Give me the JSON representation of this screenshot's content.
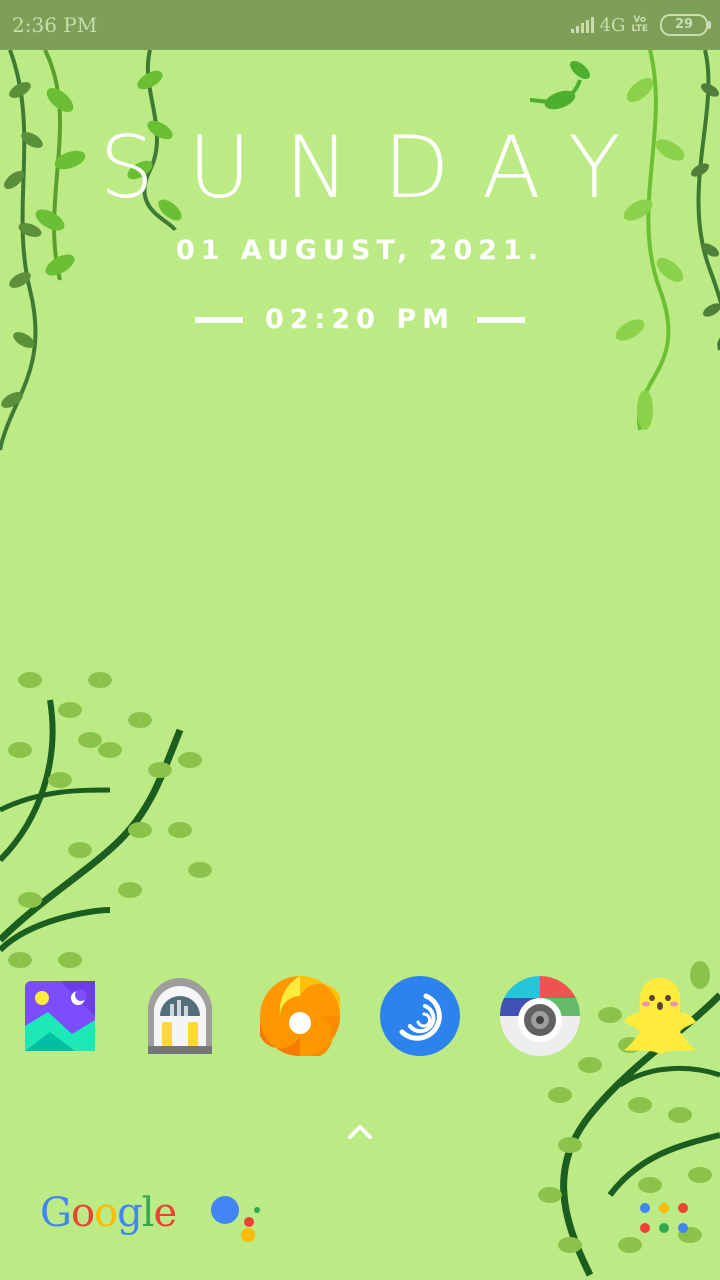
{
  "status_bar": {
    "time": "2:36 PM",
    "network": "4G",
    "volte": [
      "Vo",
      "LTE"
    ],
    "battery": "29"
  },
  "clock_widget": {
    "day": "SUNDAY",
    "date": "01 AUGUST, 2021.",
    "time": "02:20 PM"
  },
  "dock": {
    "apps": [
      {
        "icon": "gallery-icon"
      },
      {
        "icon": "soundcloud-radio-icon"
      },
      {
        "icon": "swirl-app-icon"
      },
      {
        "icon": "blue-spiral-app-icon"
      },
      {
        "icon": "camera-icon"
      },
      {
        "icon": "snapchat-ghost-icon"
      }
    ],
    "google_logo_letters": [
      "G",
      "o",
      "o",
      "g",
      "l",
      "e"
    ],
    "google_colors": [
      "#4285f4",
      "#ea4335",
      "#fbbc05",
      "#4285f4",
      "#34a853",
      "#ea4335"
    ]
  },
  "colors": {
    "wallpaper": "#bcea85",
    "status_bar": "#7e9f58",
    "leaf_light": "#8bc34a",
    "branch_dark": "#1b5e20"
  }
}
